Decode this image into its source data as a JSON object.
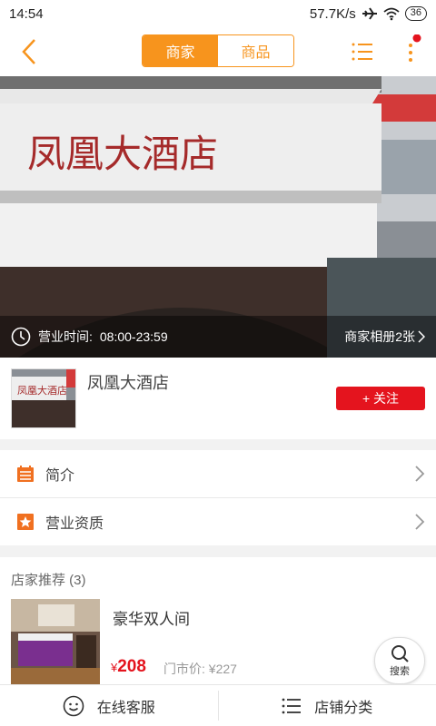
{
  "status_bar": {
    "time": "14:54",
    "network_speed": "57.7K/s",
    "battery": "36"
  },
  "header": {
    "tabs": [
      {
        "label": "商家",
        "active": true
      },
      {
        "label": "商品",
        "active": false
      }
    ],
    "accent_color": "#f7941d"
  },
  "hero": {
    "sign_text": "凤凰大酒店",
    "hours_label": "营业时间:",
    "hours_value": "08:00-23:59",
    "album_label": "商家相册2张"
  },
  "shop": {
    "name": "凤凰大酒店",
    "follow_label": "+ 关注"
  },
  "menu": [
    {
      "label": "简介",
      "icon": "document-icon"
    },
    {
      "label": "营业资质",
      "icon": "star-badge-icon"
    }
  ],
  "recommend": {
    "title": "店家推荐 (3)",
    "items": [
      {
        "name": "豪华双人间",
        "price_symbol": "¥",
        "price": "208",
        "original_price": "门市价: ¥227"
      }
    ]
  },
  "search_fab": {
    "label": "搜索"
  },
  "bottom_bar": {
    "chat_label": "在线客服",
    "category_label": "店铺分类"
  }
}
